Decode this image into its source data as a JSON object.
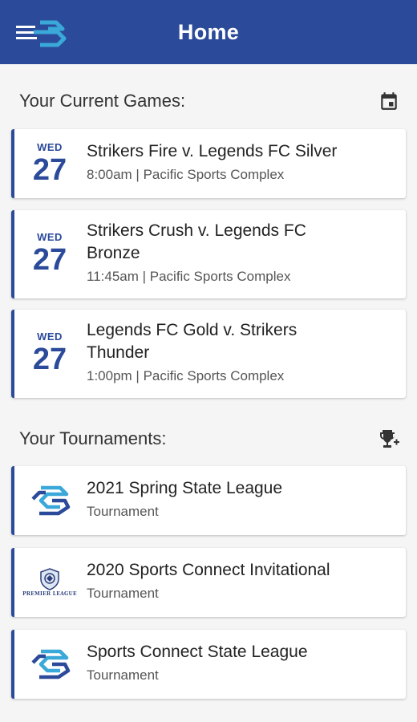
{
  "header": {
    "title": "Home",
    "menu_icon": "menu-logo-icon"
  },
  "games_section": {
    "title": "Your Current Games:",
    "action_icon": "calendar-icon",
    "games": [
      {
        "dow": "WED",
        "day": "27",
        "name": "Strikers Fire v. Legends FC Silver",
        "detail": "8:00am | Pacific Sports Complex"
      },
      {
        "dow": "WED",
        "day": "27",
        "name": "Strikers Crush v. Legends FC Bronze",
        "detail": "11:45am | Pacific Sports Complex"
      },
      {
        "dow": "WED",
        "day": "27",
        "name": "Legends FC Gold v. Strikers Thunder",
        "detail": "1:00pm | Pacific Sports Complex"
      }
    ]
  },
  "tournaments_section": {
    "title": "Your Tournaments:",
    "action_icon": "trophy-add-icon",
    "tournaments": [
      {
        "name": "2021 Spring State League",
        "type": "Tournament",
        "logo": "sports-connect-logo"
      },
      {
        "name": "2020 Sports Connect Invitational",
        "type": "Tournament",
        "logo": "premier-league-logo",
        "logo_text": "PREMIER LEAGUE"
      },
      {
        "name": "Sports Connect State League",
        "type": "Tournament",
        "logo": "sports-connect-logo"
      }
    ]
  },
  "colors": {
    "primary": "#2b4a9a",
    "logo_accent": "#3aa8d8",
    "background": "#f5f5f5"
  }
}
